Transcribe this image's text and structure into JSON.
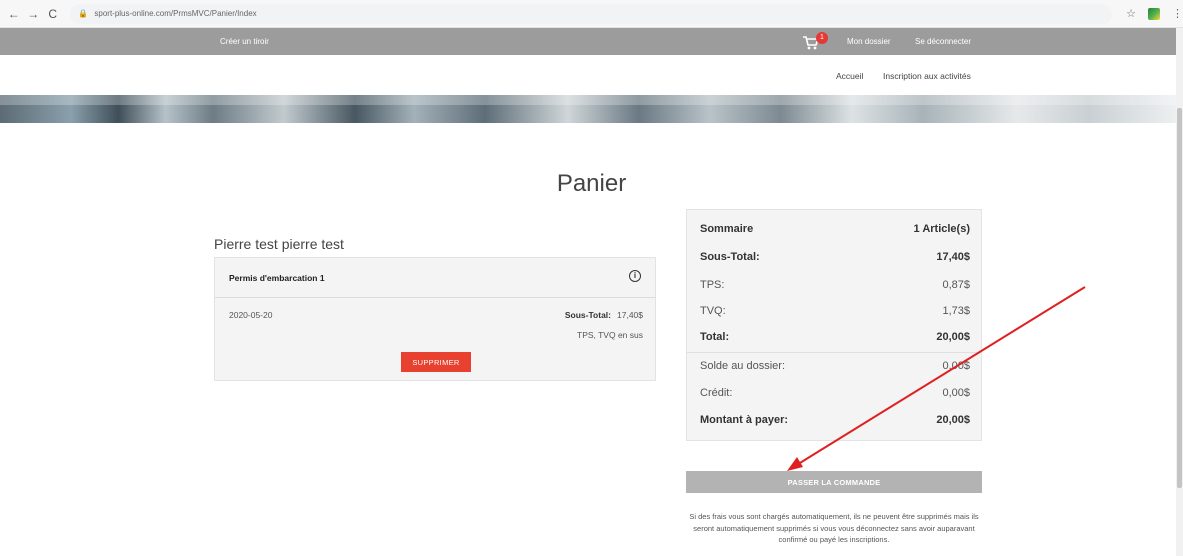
{
  "browser": {
    "url": "sport-plus-online.com/PrmsMVC/Panier/Index",
    "back_icon": "←",
    "forward_icon": "→",
    "reload_icon": "C",
    "lock_icon": "🔒",
    "star_icon": "☆",
    "menu_icon": "⋮"
  },
  "topbar": {
    "left_link": "Créer un tiroir",
    "cart_badge": "1",
    "my_dossier": "Mon dossier",
    "logout": "Se déconnecter"
  },
  "subnav": {
    "home": "Accueil",
    "registration": "Inscription aux activités"
  },
  "page": {
    "title": "Panier"
  },
  "cart": {
    "customer_name": "Pierre test pierre test",
    "item": {
      "name": "Permis d'embarcation 1",
      "date": "2020-05-20",
      "subtotal_label": "Sous-Total:",
      "subtotal_value": "17,40$",
      "taxes_note": "TPS, TVQ en sus",
      "delete_label": "SUPPRIMER"
    }
  },
  "summary": {
    "title": "Sommaire",
    "count": "1 Article(s)",
    "rows": [
      {
        "label": "Sous-Total:",
        "value": "17,40$",
        "bold": true
      },
      {
        "label": "TPS:",
        "value": "0,87$",
        "bold": false
      },
      {
        "label": "TVQ:",
        "value": "1,73$",
        "bold": false
      },
      {
        "label": "Total:",
        "value": "20,00$",
        "bold": true
      },
      {
        "label": "Solde au dossier:",
        "value": "0,00$",
        "bold": false
      },
      {
        "label": "Crédit:",
        "value": "0,00$",
        "bold": false
      },
      {
        "label": "Montant à payer:",
        "value": "20,00$",
        "bold": true
      }
    ]
  },
  "order": {
    "button_label": "PASSER LA COMMANDE",
    "disclaimer": "Si des frais vous sont chargés automatiquement, ils ne peuvent être supprimés mais ils seront automatiquement supprimés si vous vous déconnectez sans avoir auparavant confirmé ou payé les inscriptions."
  },
  "colors": {
    "topbar": "#9c9c9c",
    "delete": "#e8412f",
    "badge": "#e53935",
    "order_button": "#b3b3b3",
    "annotation_arrow": "#e02020"
  }
}
